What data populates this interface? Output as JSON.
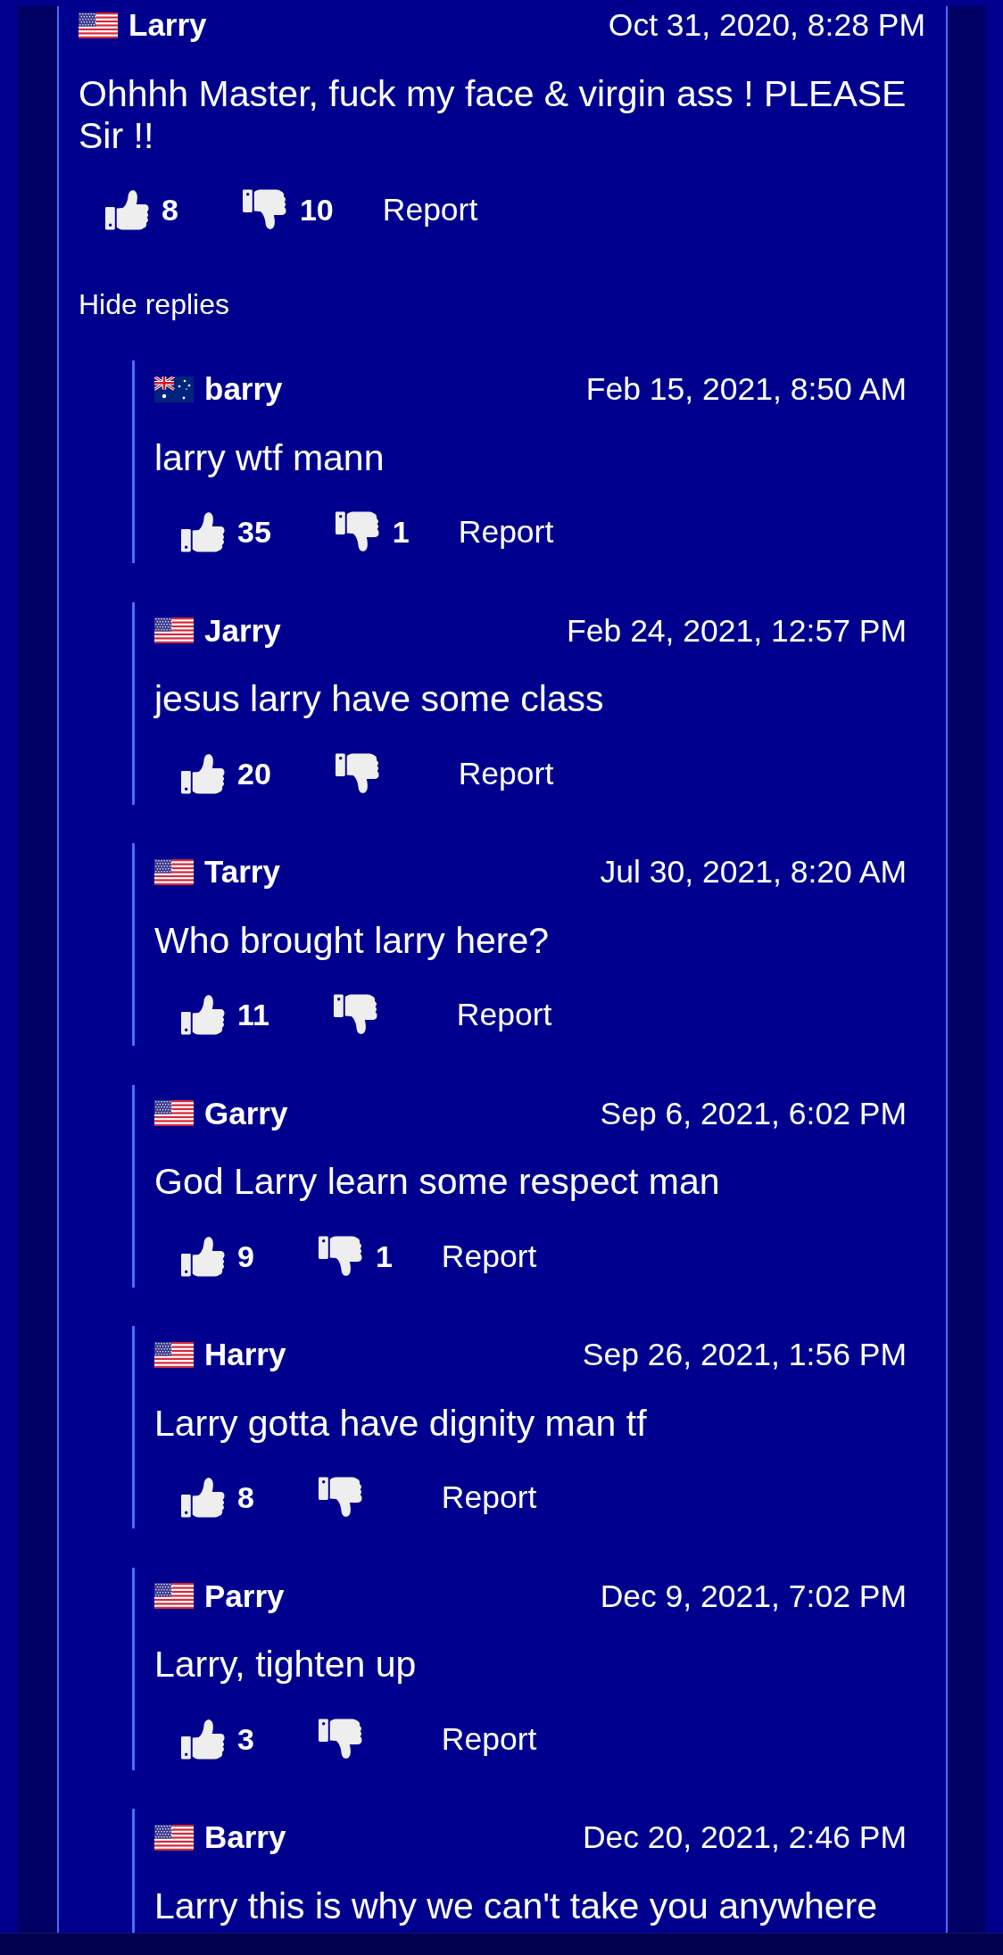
{
  "comment": {
    "author": "Larry",
    "flag": {
      "kind": "us"
    },
    "date": "Oct 31, 2020, 8:28 PM",
    "text": "Ohhhh Master, fuck my face & virgin ass ! PLEASE Sir !!",
    "likes": "8",
    "dislikes": "10",
    "report": "Report"
  },
  "hide_replies": "Hide replies",
  "replies": [
    {
      "author": "barry",
      "flag": {
        "kind": "au"
      },
      "date": "Feb 15, 2021, 8:50 AM",
      "text": "larry wtf mann",
      "likes": "35",
      "dislikes": "1",
      "report": "Report"
    },
    {
      "author": "Jarry",
      "flag": {
        "kind": "us"
      },
      "date": "Feb 24, 2021, 12:57 PM",
      "text": "jesus larry have some class",
      "likes": "20",
      "report": "Report"
    },
    {
      "author": "Tarry",
      "flag": {
        "kind": "us"
      },
      "date": "Jul 30, 2021, 8:20 AM",
      "text": "Who brought larry here?",
      "likes": "11",
      "report": "Report"
    },
    {
      "author": "Garry",
      "flag": {
        "kind": "us"
      },
      "date": "Sep 6, 2021, 6:02 PM",
      "text": "God Larry learn some respect man",
      "likes": "9",
      "dislikes": "1",
      "report": "Report"
    },
    {
      "author": "Harry",
      "flag": {
        "kind": "us"
      },
      "date": "Sep 26, 2021, 1:56 PM",
      "text": "Larry gotta have dignity man tf",
      "likes": "8",
      "report": "Report"
    },
    {
      "author": "Parry",
      "flag": {
        "kind": "us"
      },
      "date": "Dec 9, 2021, 7:02 PM",
      "text": "Larry, tighten up",
      "likes": "3",
      "report": "Report"
    },
    {
      "author": "Barry",
      "flag": {
        "kind": "us"
      },
      "date": "Dec 20, 2021, 2:46 PM",
      "text": "Larry this is why we can't take you anywhere"
    }
  ]
}
